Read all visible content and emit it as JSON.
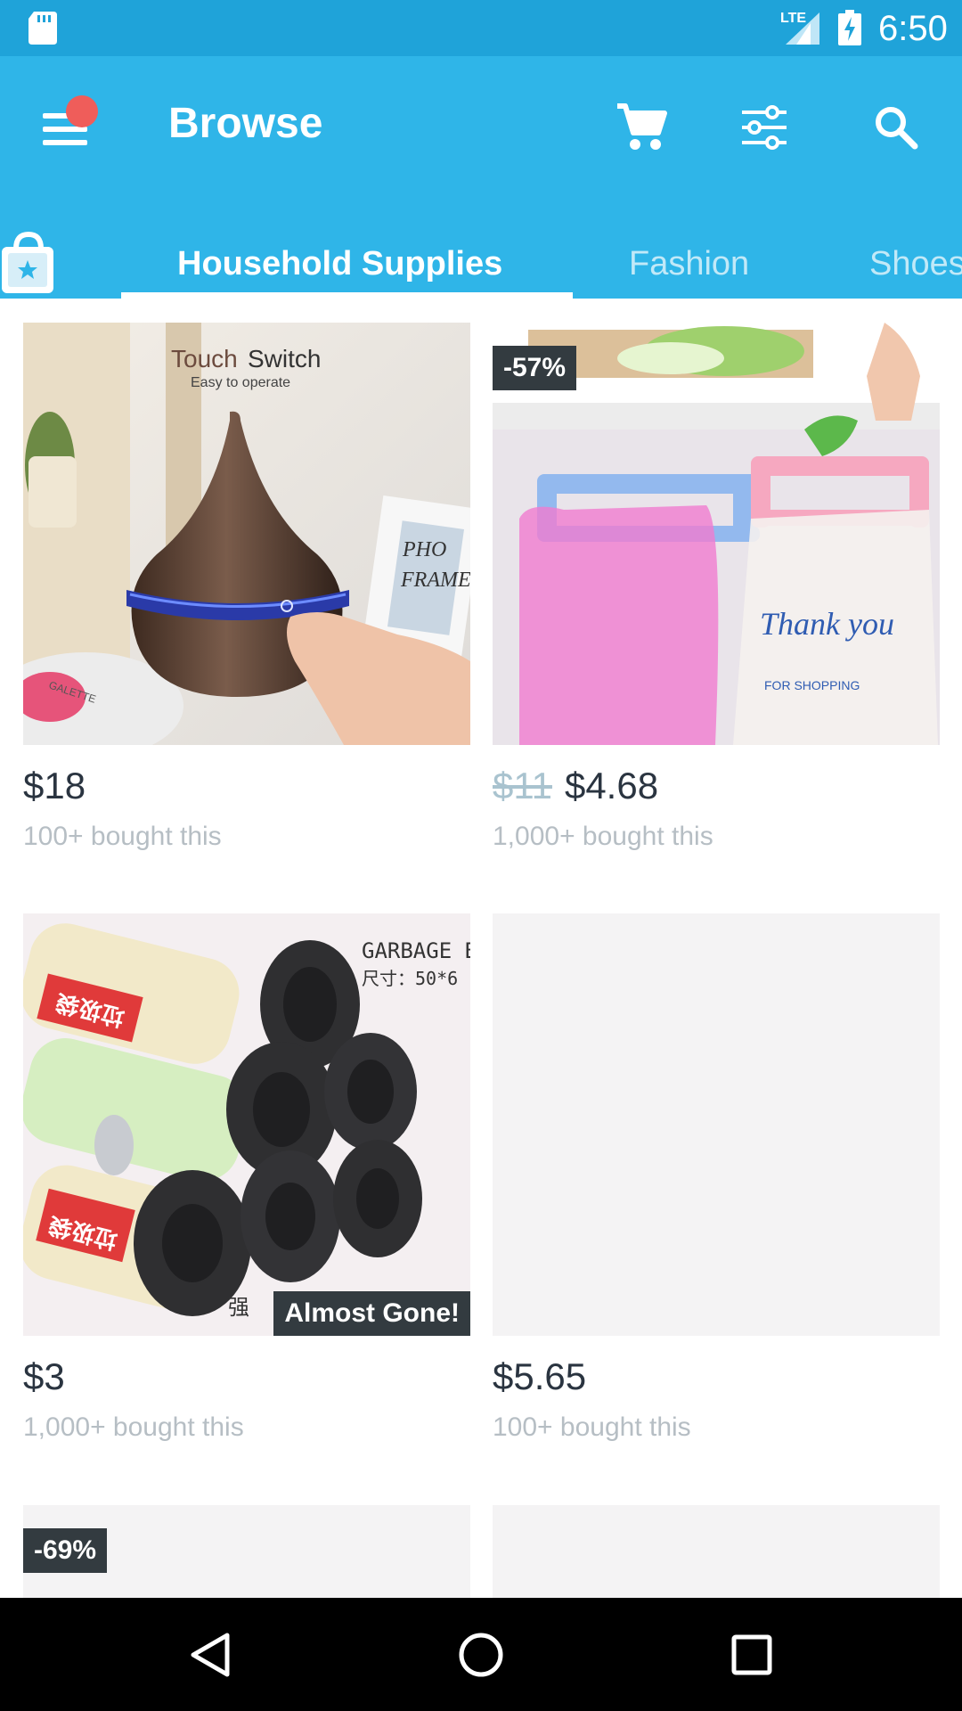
{
  "status_bar": {
    "time": "6:50",
    "network": "LTE",
    "icons": [
      "sd-card-icon",
      "signal-icon",
      "battery-charging-icon"
    ]
  },
  "app_bar": {
    "title": "Browse",
    "menu_icon": "hamburger-menu-icon",
    "notification": true,
    "actions": [
      "cart-icon",
      "filter-sliders-icon",
      "search-icon"
    ],
    "background_color": "#2fb5e8",
    "notification_color": "#ef5d5a"
  },
  "tabs": {
    "leading_icon": "shopping-bag-star-icon",
    "items": [
      {
        "label": "Household Supplies",
        "active": true
      },
      {
        "label": "Fashion",
        "active": false
      },
      {
        "label": "Shoes",
        "active": false
      }
    ]
  },
  "products": [
    {
      "image": "wood-grain aroma diffuser with touch switch",
      "image_text": {
        "title_a": "Touch",
        "title_b": " Switch",
        "subtitle": "Easy to operate",
        "frame_text_1": "PHO",
        "frame_text_2": "FRAME",
        "plate_text": "GALETTE"
      },
      "price": "$18",
      "old_price": "",
      "sold": "100+ bought this"
    },
    {
      "image": "pink and blue cabinet-door garbage bag holders",
      "badge": "-57%",
      "image_text": {
        "bag_text_1": "Thank you",
        "bag_text_2": "FOR SHOPPING"
      },
      "price": "$4.68",
      "old_price": "$11",
      "sold": "1,000+ bought this"
    },
    {
      "image": "rolls of black garbage bags",
      "image_text": {
        "label_1": "GARBAGE B",
        "label_2": "尺寸：50*6",
        "corner": "强",
        "roll_text": "垃圾袋"
      },
      "badge": "Almost Gone!",
      "price": "$3",
      "old_price": "",
      "sold": "1,000+ bought this"
    },
    {
      "image": "image loading placeholder",
      "price": "$5.65",
      "old_price": "",
      "sold": "100+ bought this"
    },
    {
      "image": "image loading placeholder",
      "badge": "-69%"
    },
    {
      "image": "image loading placeholder"
    }
  ],
  "nav_bar": {
    "buttons": [
      "back-icon",
      "home-icon",
      "recents-icon"
    ]
  }
}
